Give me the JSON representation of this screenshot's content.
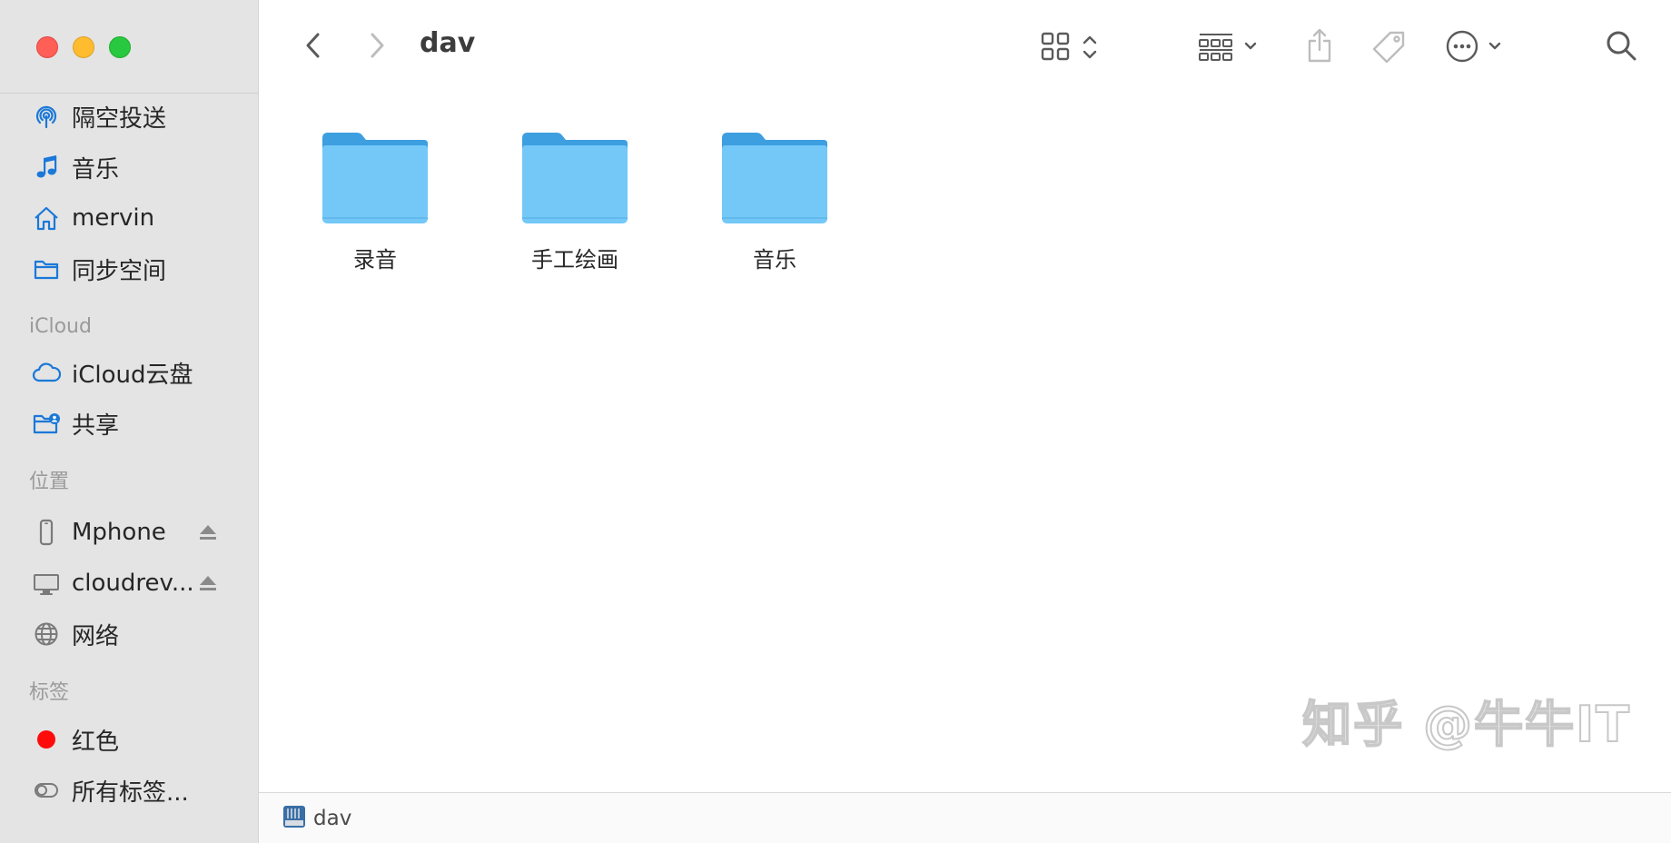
{
  "window": {
    "title": "dav",
    "status_path": "dav"
  },
  "sidebar": {
    "favorites": [
      {
        "label": "隔空投送",
        "icon": "airdrop-icon"
      },
      {
        "label": "音乐",
        "icon": "music-note-icon"
      },
      {
        "label": "mervin",
        "icon": "home-icon"
      },
      {
        "label": "同步空间",
        "icon": "folder-icon"
      }
    ],
    "icloud_heading": "iCloud",
    "icloud": [
      {
        "label": "iCloud云盘",
        "icon": "cloud-icon"
      },
      {
        "label": "共享",
        "icon": "shared-folder-icon"
      }
    ],
    "locations_heading": "位置",
    "locations": [
      {
        "label": "Mphone",
        "icon": "iphone-icon",
        "ejectable": true
      },
      {
        "label": "cloudrev...",
        "icon": "display-icon",
        "ejectable": true
      },
      {
        "label": "网络",
        "icon": "network-globe-icon",
        "ejectable": false
      }
    ],
    "tags_heading": "标签",
    "tags": [
      {
        "label": "红色",
        "icon": "red-tag-dot",
        "color": "#fe0c0c"
      },
      {
        "label": "所有标签...",
        "icon": "all-tags-icon"
      }
    ]
  },
  "toolbar": {
    "back": "chevron-left-icon",
    "forward": "chevron-right-icon",
    "view_mode": "icon-grid-icon",
    "group": "group-grid-icon",
    "share": "share-icon",
    "tag": "tag-icon",
    "more": "ellipsis-circle-icon",
    "search": "search-icon"
  },
  "files": [
    {
      "name": "录音"
    },
    {
      "name": "手工绘画"
    },
    {
      "name": "音乐"
    }
  ],
  "watermark": "知乎 @牛牛IT",
  "colors": {
    "folder_body": "#73c8f8",
    "folder_tab": "#3d9fe0",
    "accent": "#1b78d8"
  }
}
